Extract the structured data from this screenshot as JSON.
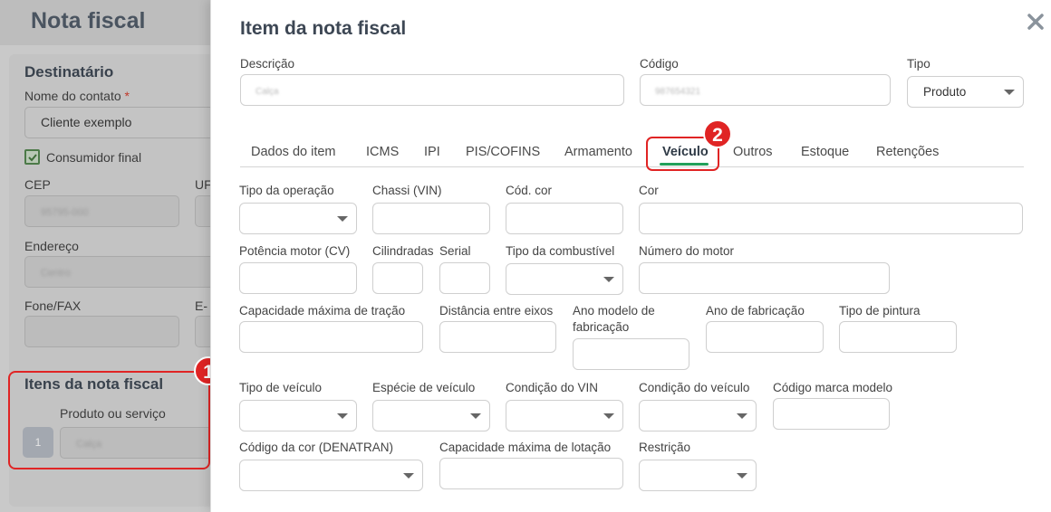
{
  "background": {
    "page_title": "Nota fiscal",
    "destinatario": {
      "title": "Destinatário",
      "contact_label": "Nome do contato",
      "required_mark": "*",
      "contact_value": "Cliente exemplo",
      "consumer_label": "Consumidor final",
      "cep_label": "CEP",
      "cep_value": "95795-000",
      "uf_label": "UF",
      "endereco_label": "Endereço",
      "endereco_value": "Centro",
      "fone_label": "Fone/FAX",
      "email_label": "E-m"
    },
    "itens": {
      "title": "Itens da nota fiscal",
      "product_label": "Produto ou serviço",
      "index": "1",
      "product_value": "Calça"
    }
  },
  "callouts": {
    "one": "1",
    "two": "2"
  },
  "modal": {
    "title": "Item da nota fiscal",
    "close_label": "✕",
    "descricao_label": "Descrição",
    "descricao_value": "Calça",
    "codigo_label": "Código",
    "codigo_value": "987654321",
    "tipo_label": "Tipo",
    "tipo_value": "Produto",
    "tabs": [
      "Dados do item",
      "ICMS",
      "IPI",
      "PIS/COFINS",
      "Armamento",
      "Veículo",
      "Outros",
      "Estoque",
      "Retenções"
    ],
    "active_tab": "Veículo",
    "fields": {
      "tipo_operacao": "Tipo da operação",
      "chassi": "Chassi (VIN)",
      "cod_cor": "Cód. cor",
      "cor": "Cor",
      "potencia": "Potência motor (CV)",
      "cilindradas": "Cilindradas",
      "serial": "Serial",
      "tipo_combustivel": "Tipo da combustível",
      "numero_motor": "Número do motor",
      "capacidade_tracao": "Capacidade máxima de tração",
      "distancia_eixos": "Distância entre eixos",
      "ano_modelo": "Ano modelo de fabricação",
      "ano_fabricacao": "Ano de fabricação",
      "tipo_pintura": "Tipo de pintura",
      "tipo_veiculo": "Tipo de veículo",
      "especie_veiculo": "Espécie de veículo",
      "condicao_vin": "Condição do VIN",
      "condicao_veiculo": "Condição do veículo",
      "codigo_marca": "Código marca modelo",
      "codigo_cor_denatran": "Código da cor (DENATRAN)",
      "capacidade_lotacao": "Capacidade máxima de lotação",
      "restricao": "Restrição"
    }
  },
  "colors": {
    "accent_green": "#22a05a",
    "callout_red": "#e02424",
    "title_text": "#3d4754"
  }
}
